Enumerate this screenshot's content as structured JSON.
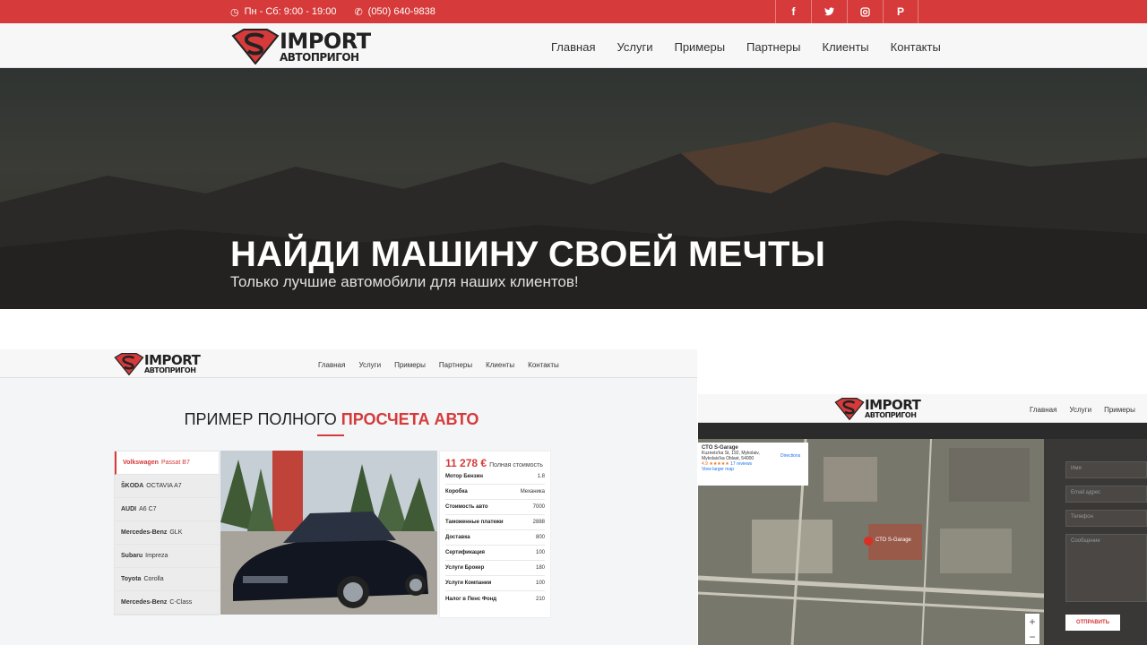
{
  "topbar": {
    "hours": "Пн - Сб: 9:00 - 19:00",
    "phone": "(050) 640-9838",
    "social": [
      "f",
      "t",
      "ig",
      "p"
    ],
    "social_icons": [
      "facebook-icon",
      "twitter-icon",
      "instagram-icon",
      "pinterest-icon"
    ]
  },
  "brand": {
    "line1": "IMPORT",
    "line2": "АВТОПРИГОН"
  },
  "nav": [
    "Главная",
    "Услуги",
    "Примеры",
    "Партнеры",
    "Клиенты",
    "Контакты"
  ],
  "hero": {
    "title": "НАЙДИ МАШИНУ СВОЕЙ МЕЧТЫ",
    "subtitle": "Только лучшие автомобили для наших клиентов!"
  },
  "calc": {
    "title_plain": "ПРИМЕР ПОЛНОГО",
    "title_accent": "ПРОСЧЕТА АВТО",
    "cars": [
      {
        "make": "Volkswagen",
        "model": "Passat B7",
        "active": true
      },
      {
        "make": "ŠKODA",
        "model": "OCTAVIA A7"
      },
      {
        "make": "AUDI",
        "model": "A6 C7"
      },
      {
        "make": "Mercedes-Benz",
        "model": "GLK"
      },
      {
        "make": "Subaru",
        "model": "Impreza"
      },
      {
        "make": "Toyota",
        "model": "Corolla"
      },
      {
        "make": "Mercedes-Benz",
        "model": "C-Class"
      }
    ],
    "price": "11 278 €",
    "price_label": "Полная стоимость",
    "specs": [
      {
        "label": "Мотор Бензин",
        "value": "1.8"
      },
      {
        "label": "Коробка",
        "value": "Механика"
      },
      {
        "label": "Стоимость авто",
        "value": "7000"
      },
      {
        "label": "Таможенные платежи",
        "value": "2888"
      },
      {
        "label": "Доставка",
        "value": "800"
      },
      {
        "label": "Сертификация",
        "value": "100"
      },
      {
        "label": "Услуги Брокер",
        "value": "180"
      },
      {
        "label": "Услуги Компании",
        "value": "100"
      },
      {
        "label": "Налог в Пенс Фонд",
        "value": "210"
      }
    ]
  },
  "contact": {
    "nav": [
      "Главная",
      "Услуги",
      "Примеры"
    ],
    "map": {
      "place": "СТО S-Garage",
      "address": "Kuznets'ka St, 192, Mykolaiv, Mykolais'ka Oblast, 54000",
      "rating": "4.9 ★★★★★",
      "reviews": "17 reviews",
      "directions": "Directions",
      "larger": "View larger map",
      "pin_label": "СТО S-Garage",
      "zoom_in": "+",
      "zoom_out": "−"
    },
    "form": {
      "name": "Имя",
      "email": "Email адрес",
      "phone": "Телефон",
      "message": "Сообщение",
      "submit": "ОТПРАВИТЬ"
    }
  }
}
